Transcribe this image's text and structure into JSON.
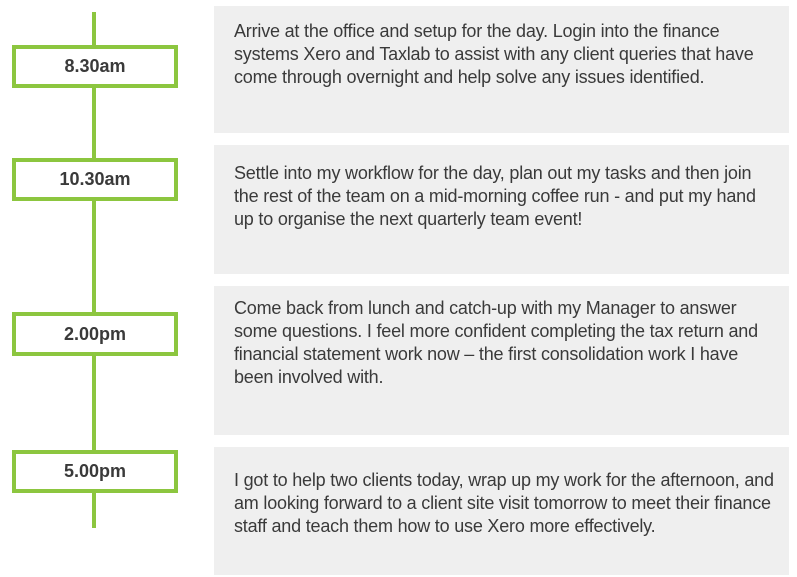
{
  "entries": [
    {
      "time": "8.30am",
      "text": "Arrive at the office and setup for the day. Login into the finance systems Xero and Taxlab to assist with any client queries that have come through overnight and help solve any issues identified."
    },
    {
      "time": "10.30am",
      "text": "Settle into my workflow for the day, plan out my tasks and then join the rest of the team on a mid-morning coffee run - and put my hand up to organise the next quarterly team event!"
    },
    {
      "time": "2.00pm",
      "text": "Come back from lunch and catch-up with my Manager to answer some questions.  I feel more confident completing the tax return and financial statement work now – the first consolidation work I have been involved with."
    },
    {
      "time": "5.00pm",
      "text": "I got to help two clients today, wrap up my work for the afternoon, and am looking forward to a client site visit tomorrow to meet their finance staff and teach them how to use Xero more effectively."
    }
  ],
  "colors": {
    "accent": "#8cc63f",
    "card_background": "#efefef",
    "text": "#3a3a3a"
  }
}
